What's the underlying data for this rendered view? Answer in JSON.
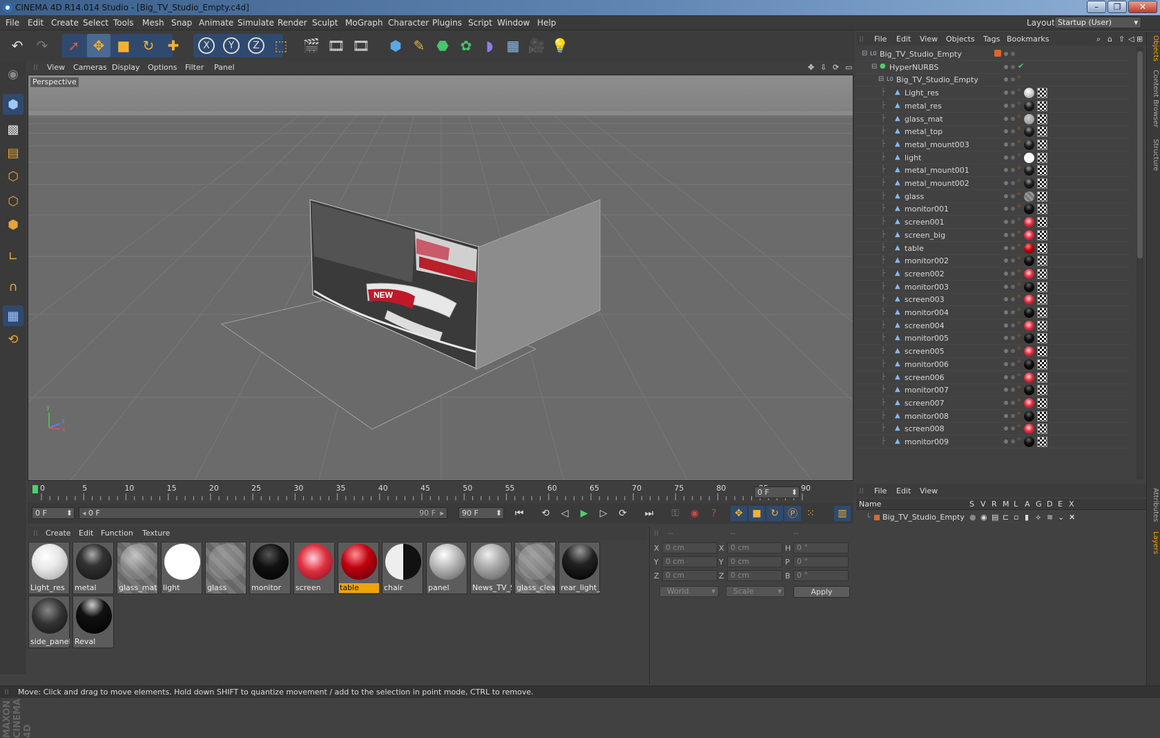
{
  "window": {
    "title": "CINEMA 4D R14.014 Studio - [Big_TV_Studio_Empty.c4d]",
    "minimize": "–",
    "maximize": "❐",
    "close": "✕"
  },
  "menu": [
    "File",
    "Edit",
    "Create",
    "Select",
    "Tools",
    "Mesh",
    "Snap",
    "Animate",
    "Simulate",
    "Render",
    "Sculpt",
    "MoGraph",
    "Character",
    "Plugins",
    "Script",
    "Window",
    "Help"
  ],
  "layout": {
    "label": "Layout:",
    "value": "Startup (User)"
  },
  "viewport": {
    "menu": [
      "View",
      "Cameras",
      "Display",
      "Options",
      "Filter",
      "Panel"
    ],
    "label": "Perspective",
    "axis": {
      "y": "y",
      "z": "z",
      "x": "x"
    }
  },
  "timeline": {
    "ticks": [
      "0",
      "5",
      "10",
      "15",
      "20",
      "25",
      "30",
      "35",
      "40",
      "45",
      "50",
      "55",
      "60",
      "65",
      "70",
      "75",
      "80",
      "85",
      "90"
    ],
    "current": "0 F"
  },
  "transport": {
    "start": "0 F",
    "range_start": "0 F",
    "range_end": "90 F",
    "end": "90 F"
  },
  "materials": {
    "menu": [
      "Create",
      "Edit",
      "Function",
      "Texture"
    ],
    "items": [
      {
        "name": "Light_res"
      },
      {
        "name": "metal"
      },
      {
        "name": "glass_mat"
      },
      {
        "name": "light"
      },
      {
        "name": "glass"
      },
      {
        "name": "monitor"
      },
      {
        "name": "screen"
      },
      {
        "name": "table",
        "selected": true
      },
      {
        "name": "chair"
      },
      {
        "name": "panel"
      },
      {
        "name": "News_TV_S"
      },
      {
        "name": "glass_clear"
      },
      {
        "name": "rear_light_"
      },
      {
        "name": "side_panel"
      },
      {
        "name": "Reval"
      }
    ]
  },
  "coordinates": {
    "headers": [
      "--",
      "--",
      "--"
    ],
    "rows": [
      {
        "a": "X",
        "av": "0 cm",
        "b": "X",
        "bv": "0 cm",
        "c": "H",
        "cv": "0 °"
      },
      {
        "a": "Y",
        "av": "0 cm",
        "b": "Y",
        "bv": "0 cm",
        "c": "P",
        "cv": "0 °"
      },
      {
        "a": "Z",
        "av": "0 cm",
        "b": "Z",
        "bv": "0 cm",
        "c": "B",
        "cv": "0 °"
      }
    ],
    "mode": "World",
    "type": "Scale",
    "apply": "Apply"
  },
  "objects": {
    "menu": [
      "File",
      "Edit",
      "View",
      "Objects",
      "Tags",
      "Bookmarks"
    ],
    "rows": [
      {
        "name": "Big_TV_Studio_Empty",
        "level": 0
      },
      {
        "name": "HyperNURBS",
        "level": 1
      },
      {
        "name": "Big_TV_Studio_Empty",
        "level": 2
      },
      {
        "name": "Light_res",
        "level": 3
      },
      {
        "name": "metal_res",
        "level": 3
      },
      {
        "name": "glass_mat",
        "level": 3
      },
      {
        "name": "metal_top",
        "level": 3
      },
      {
        "name": "metal_mount003",
        "level": 3
      },
      {
        "name": "light",
        "level": 3
      },
      {
        "name": "metal_mount001",
        "level": 3
      },
      {
        "name": "metal_mount002",
        "level": 3
      },
      {
        "name": "glass",
        "level": 3
      },
      {
        "name": "monitor001",
        "level": 3
      },
      {
        "name": "screen001",
        "level": 3
      },
      {
        "name": "screen_big",
        "level": 3
      },
      {
        "name": "table",
        "level": 3
      },
      {
        "name": "monitor002",
        "level": 3
      },
      {
        "name": "screen002",
        "level": 3
      },
      {
        "name": "monitor003",
        "level": 3
      },
      {
        "name": "screen003",
        "level": 3
      },
      {
        "name": "monitor004",
        "level": 3
      },
      {
        "name": "screen004",
        "level": 3
      },
      {
        "name": "monitor005",
        "level": 3
      },
      {
        "name": "screen005",
        "level": 3
      },
      {
        "name": "monitor006",
        "level": 3
      },
      {
        "name": "screen006",
        "level": 3
      },
      {
        "name": "monitor007",
        "level": 3
      },
      {
        "name": "screen007",
        "level": 3
      },
      {
        "name": "monitor008",
        "level": 3
      },
      {
        "name": "screen008",
        "level": 3
      },
      {
        "name": "monitor009",
        "level": 3
      }
    ]
  },
  "layers": {
    "menu": [
      "File",
      "Edit",
      "View"
    ],
    "columns": [
      "Name",
      "S",
      "V",
      "R",
      "M",
      "L",
      "A",
      "G",
      "D",
      "E",
      "X"
    ],
    "rows": [
      {
        "name": "Big_TV_Studio_Empty"
      }
    ]
  },
  "sidetabs": [
    "Objects",
    "Content Browser",
    "Structure",
    "Attributes",
    "Layers"
  ],
  "status": "Move: Click and drag to move elements. Hold down SHIFT to quantize movement / add to the selection in point mode, CTRL to remove.",
  "brand": "MAXON CINEMA 4D"
}
